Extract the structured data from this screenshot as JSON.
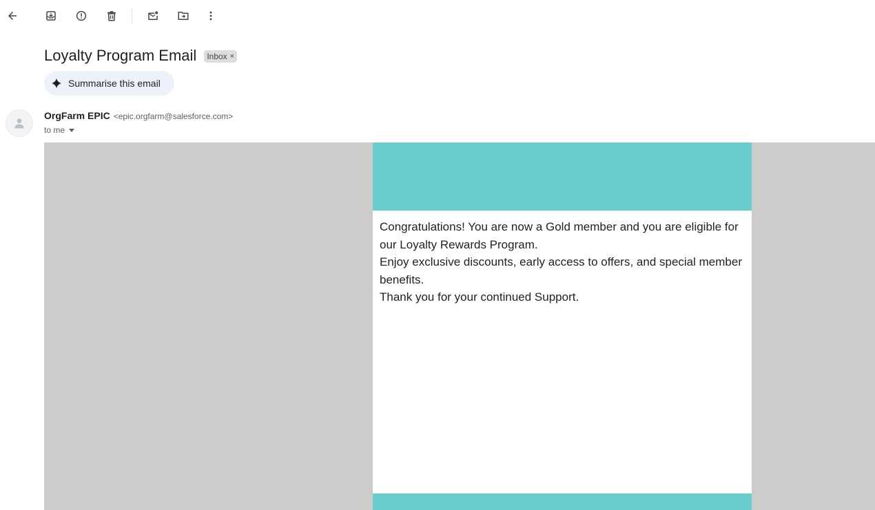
{
  "toolbar": {
    "icons": [
      "back-arrow-icon",
      "archive-icon",
      "report-spam-icon",
      "delete-icon",
      "mark-unread-icon",
      "move-to-icon",
      "more-vert-icon"
    ]
  },
  "email": {
    "subject": "Loyalty Program Email",
    "label": "Inbox",
    "label_remove": "×",
    "summarise_label": "Summarise this email",
    "sender_name": "OrgFarm EPIC",
    "sender_email": "<epic.orgfarm@salesforce.com>",
    "recipient_label": "to me",
    "body": {
      "line1": "Congratulations! You are now a Gold member and you are eligible for our Loyalty Rewards Program.",
      "line2": "Enjoy exclusive discounts, early access to offers, and special member benefits.",
      "line3": "Thank you for your continued Support."
    },
    "colors": {
      "banner": "#68cdcc",
      "outer_background": "#cccccc"
    }
  }
}
